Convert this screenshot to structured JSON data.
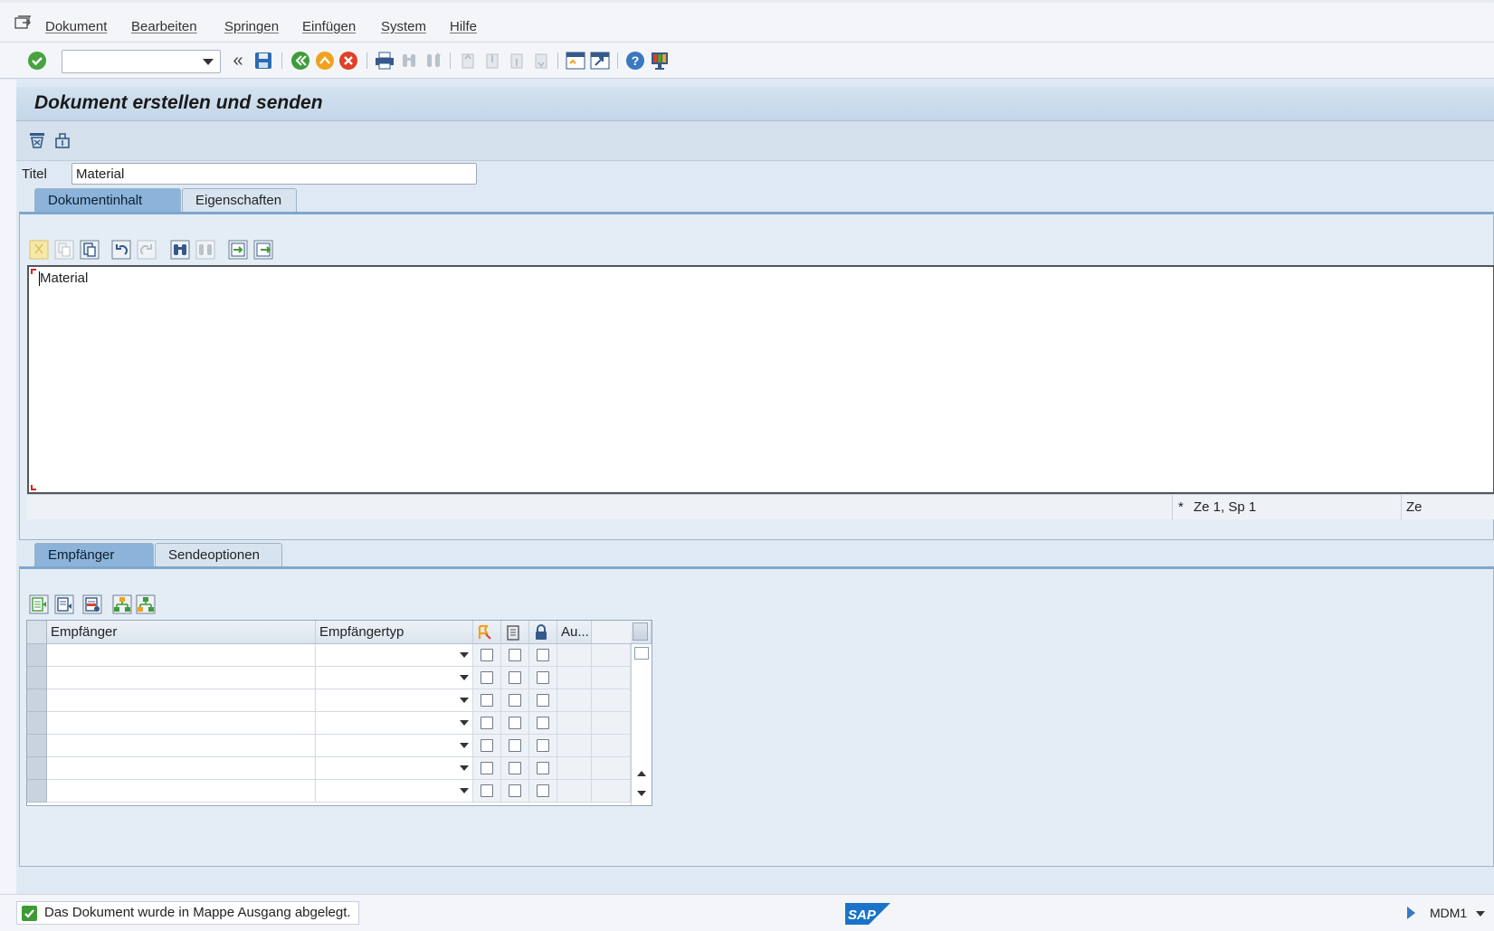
{
  "menubar": {
    "items": [
      "Dokument",
      "Bearbeiten",
      "Springen",
      "Einfügen",
      "System",
      "Hilfe"
    ]
  },
  "toolbar": {
    "command_field_value": "",
    "nav_back_label": "«"
  },
  "screen": {
    "title": "Dokument erstellen und senden"
  },
  "form": {
    "title_label": "Titel",
    "title_value": "Material"
  },
  "doc_tabs": [
    {
      "label": "Dokumentinhalt",
      "active": true
    },
    {
      "label": "Eigenschaften",
      "active": false
    }
  ],
  "editor": {
    "content": "Material",
    "status_marker": "*",
    "position": "Ze 1, Sp 1",
    "position_cut": "Ze"
  },
  "recipient_tabs": [
    {
      "label": "Empfänger",
      "active": true
    },
    {
      "label": "Sendeoptionen",
      "active": false
    }
  ],
  "recipient_table": {
    "columns": [
      "Empfänger",
      "Empfängertyp",
      "",
      "",
      "",
      "Au..."
    ],
    "rows": [
      {
        "recipient": "",
        "type": "",
        "express": false,
        "copy": false,
        "blind": false
      },
      {
        "recipient": "",
        "type": "",
        "express": false,
        "copy": false,
        "blind": false
      },
      {
        "recipient": "",
        "type": "",
        "express": false,
        "copy": false,
        "blind": false
      },
      {
        "recipient": "",
        "type": "",
        "express": false,
        "copy": false,
        "blind": false
      },
      {
        "recipient": "",
        "type": "",
        "express": false,
        "copy": false,
        "blind": false
      },
      {
        "recipient": "",
        "type": "",
        "express": false,
        "copy": false,
        "blind": false
      },
      {
        "recipient": "",
        "type": "",
        "express": false,
        "copy": false,
        "blind": false
      }
    ]
  },
  "statusbar": {
    "message": "Das Dokument wurde in Mappe Ausgang abgelegt.",
    "system": "MDM1",
    "logo": "SAP"
  },
  "colors": {
    "accent": "#7fa6cc",
    "success": "#3d9b35",
    "cancel": "#e0402a",
    "title_bar": "#c4d6e8"
  }
}
